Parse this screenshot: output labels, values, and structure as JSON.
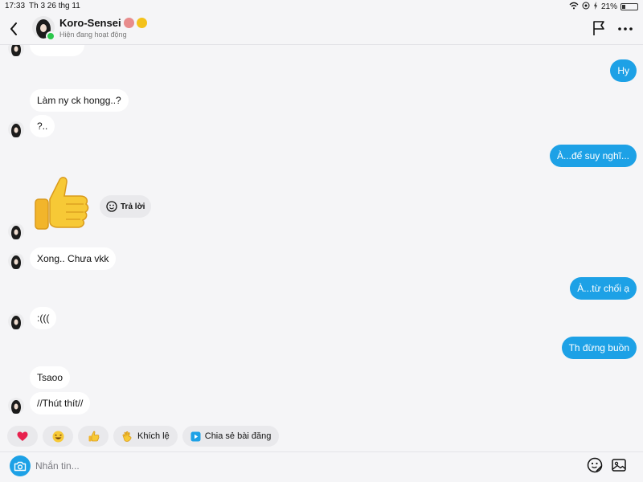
{
  "status_bar": {
    "time": "17:33",
    "date": "Th 3 26 thg 11",
    "battery": "21%",
    "battery_level": 0.21
  },
  "header": {
    "name": "Koro-Sensei",
    "status": "Hiện đang hoạt động",
    "icons": [
      "back-icon",
      "flag-icon",
      "more-icon"
    ]
  },
  "messages": [
    {
      "side": "out",
      "text": "Hy"
    },
    {
      "side": "in",
      "text": "Làm ny ck hongg..?"
    },
    {
      "side": "in",
      "text": "?.."
    },
    {
      "side": "out",
      "text": "À...để suy nghĩ..."
    },
    {
      "side": "in",
      "type": "sticker",
      "sticker": "thumbs-up"
    },
    {
      "side": "in",
      "text": "Xong.. Chưa vkk"
    },
    {
      "side": "out",
      "text": "À...từ chối ạ"
    },
    {
      "side": "in",
      "text": ":((("
    },
    {
      "side": "out",
      "text": "Th đừng buồn"
    },
    {
      "side": "in",
      "text": "Tsaoo"
    },
    {
      "side": "in",
      "text": "//Thút thít//"
    }
  ],
  "reply_chip": {
    "label": "Trả lời"
  },
  "quick_replies": [
    {
      "icon": "heart-icon"
    },
    {
      "icon": "laughing-face-icon"
    },
    {
      "icon": "thumbs-up-icon"
    },
    {
      "icon": "clap-hand-icon",
      "label": "Khích lệ"
    },
    {
      "icon": "share-post-icon",
      "label": "Chia sẻ bài đăng"
    }
  ],
  "composer": {
    "placeholder": "Nhắn tin..."
  },
  "colors": {
    "outgoing_bubble": "#1da1e6",
    "incoming_bubble": "#ffffff",
    "online": "#2bc74b",
    "background": "#f5f5f7"
  }
}
